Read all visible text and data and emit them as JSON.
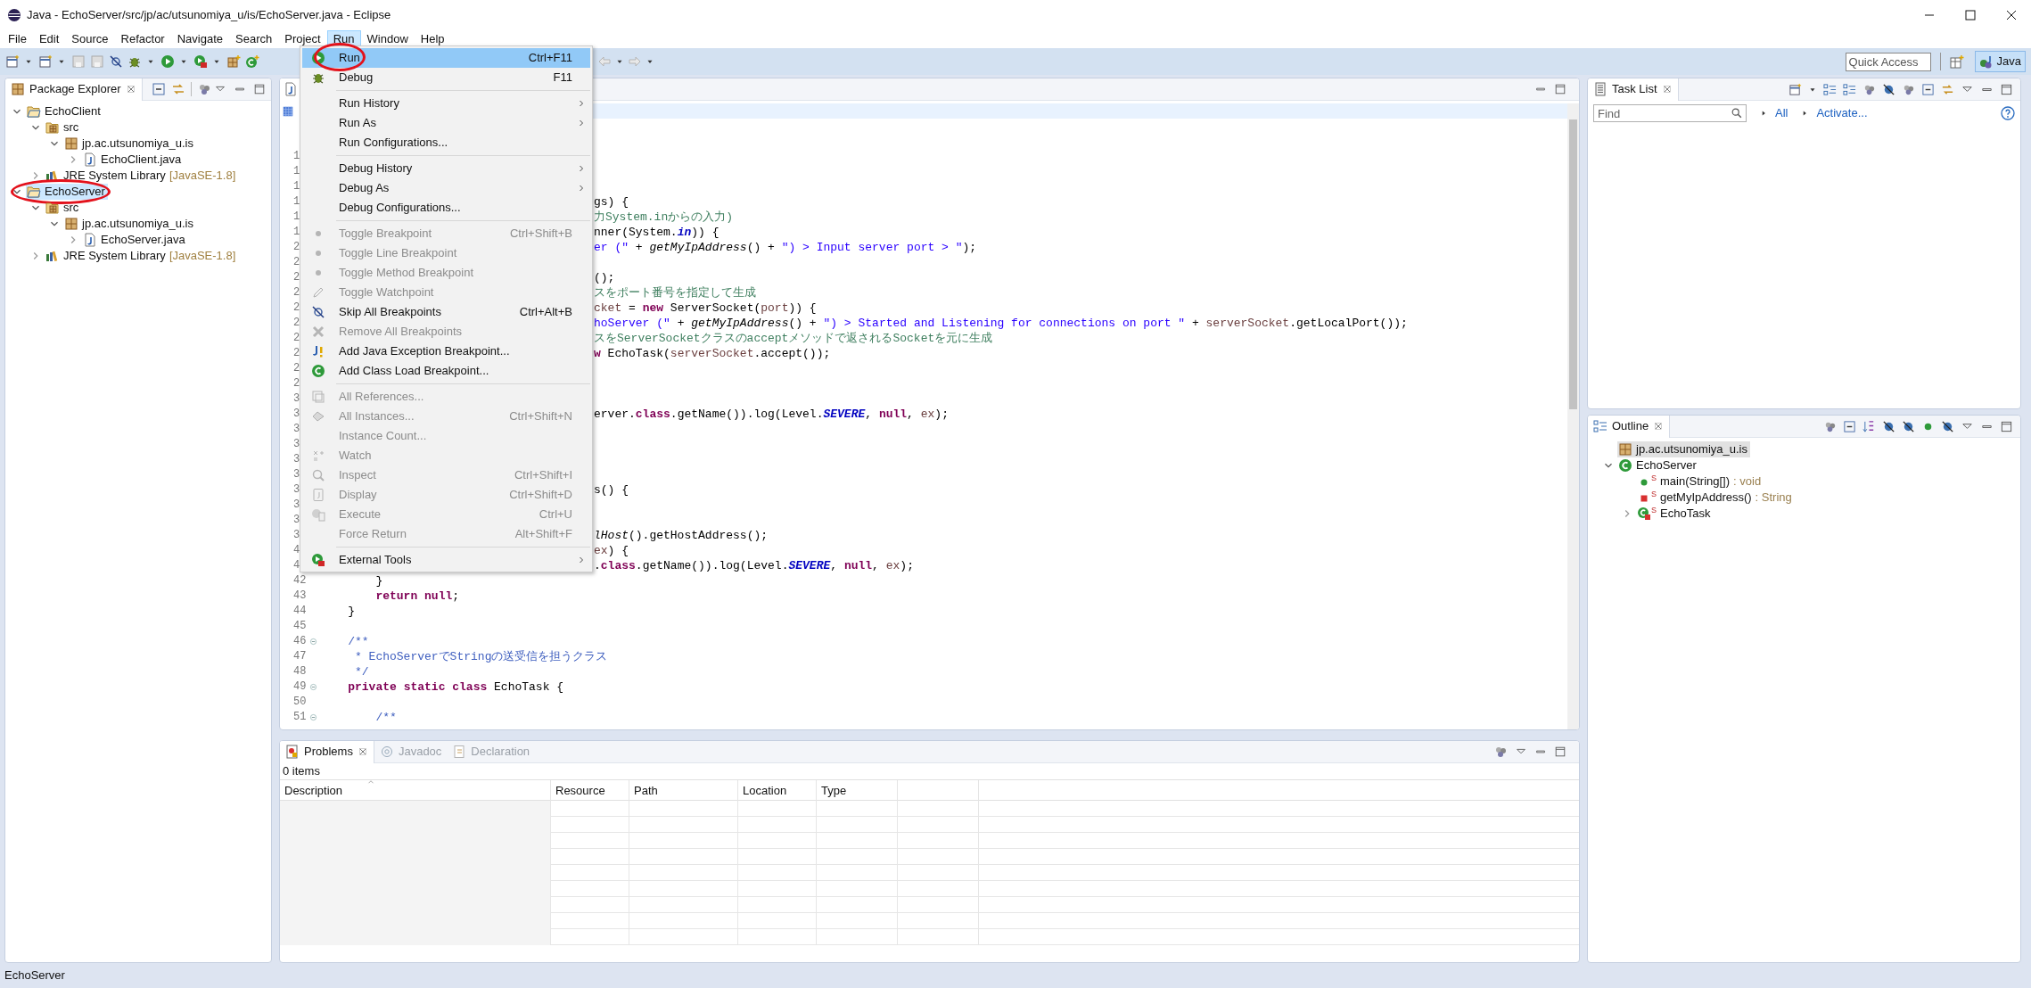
{
  "window": {
    "title": "Java - EchoServer/src/jp/ac/utsunomiya_u/is/EchoServer.java - Eclipse"
  },
  "menu_bar": [
    {
      "label": "File",
      "selected": false
    },
    {
      "label": "Edit",
      "selected": false
    },
    {
      "label": "Source",
      "selected": false
    },
    {
      "label": "Refactor",
      "selected": false
    },
    {
      "label": "Navigate",
      "selected": false
    },
    {
      "label": "Search",
      "selected": false
    },
    {
      "label": "Project",
      "selected": false
    },
    {
      "label": "Run",
      "selected": true
    },
    {
      "label": "Window",
      "selected": false
    },
    {
      "label": "Help",
      "selected": false
    }
  ],
  "toolbar": {
    "quick_access": {
      "placeholder": "Quick Access"
    },
    "perspective": {
      "label": "Java",
      "selected": true
    }
  },
  "run_menu": {
    "groups": [
      {
        "items": [
          {
            "label": "Run",
            "shortcut": "Ctrl+F11",
            "submenu": false,
            "disabled": false,
            "selected": true,
            "annotated": true
          },
          {
            "label": "Debug",
            "shortcut": "F11",
            "submenu": false,
            "disabled": false,
            "selected": false,
            "annotated": false
          }
        ]
      },
      {
        "items": [
          {
            "label": "Run History",
            "submenu": true,
            "disabled": false,
            "selected": false,
            "annotated": false
          },
          {
            "label": "Run As",
            "submenu": true,
            "disabled": false,
            "selected": false,
            "annotated": false
          },
          {
            "label": "Run Configurations...",
            "submenu": false,
            "disabled": false,
            "selected": false,
            "annotated": false
          }
        ]
      },
      {
        "items": [
          {
            "label": "Debug History",
            "submenu": true,
            "disabled": false,
            "selected": false,
            "annotated": false
          },
          {
            "label": "Debug As",
            "submenu": true,
            "disabled": false,
            "selected": false,
            "annotated": false
          },
          {
            "label": "Debug Configurations...",
            "submenu": false,
            "disabled": false,
            "selected": false,
            "annotated": false
          }
        ]
      },
      {
        "items": [
          {
            "label": "Toggle Breakpoint",
            "shortcut": "Ctrl+Shift+B",
            "submenu": false,
            "disabled": true,
            "selected": false,
            "annotated": false
          },
          {
            "label": "Toggle Line Breakpoint",
            "submenu": false,
            "disabled": true,
            "selected": false,
            "annotated": false
          },
          {
            "label": "Toggle Method Breakpoint",
            "submenu": false,
            "disabled": true,
            "selected": false,
            "annotated": false
          },
          {
            "label": "Toggle Watchpoint",
            "submenu": false,
            "disabled": true,
            "selected": false,
            "annotated": false
          },
          {
            "label": "Skip All Breakpoints",
            "shortcut": "Ctrl+Alt+B",
            "submenu": false,
            "disabled": false,
            "selected": false,
            "annotated": false
          },
          {
            "label": "Remove All Breakpoints",
            "submenu": false,
            "disabled": true,
            "selected": false,
            "annotated": false
          },
          {
            "label": "Add Java Exception Breakpoint...",
            "submenu": false,
            "disabled": false,
            "selected": false,
            "annotated": false
          },
          {
            "label": "Add Class Load Breakpoint...",
            "submenu": false,
            "disabled": false,
            "selected": false,
            "annotated": false
          }
        ]
      },
      {
        "items": [
          {
            "label": "All References...",
            "submenu": false,
            "disabled": true,
            "selected": false,
            "annotated": false
          },
          {
            "label": "All Instances...",
            "shortcut": "Ctrl+Shift+N",
            "submenu": false,
            "disabled": true,
            "selected": false,
            "annotated": false
          },
          {
            "label": "Instance Count...",
            "submenu": false,
            "disabled": true,
            "selected": false,
            "annotated": false
          },
          {
            "label": "Watch",
            "submenu": false,
            "disabled": true,
            "selected": false,
            "annotated": false
          },
          {
            "label": "Inspect",
            "shortcut": "Ctrl+Shift+I",
            "submenu": false,
            "disabled": true,
            "selected": false,
            "annotated": false
          },
          {
            "label": "Display",
            "shortcut": "Ctrl+Shift+D",
            "submenu": false,
            "disabled": true,
            "selected": false,
            "annotated": false
          },
          {
            "label": "Execute",
            "shortcut": "Ctrl+U",
            "submenu": false,
            "disabled": true,
            "selected": false,
            "annotated": false
          },
          {
            "label": "Force Return",
            "shortcut": "Alt+Shift+F",
            "submenu": false,
            "disabled": true,
            "selected": false,
            "annotated": false
          }
        ]
      },
      {
        "items": [
          {
            "label": "External Tools",
            "submenu": true,
            "disabled": false,
            "selected": false,
            "annotated": false
          }
        ]
      }
    ]
  },
  "package_explorer": {
    "title": "Package Explorer",
    "tree": [
      {
        "label": "EchoClient",
        "kind": "project",
        "expanded": true,
        "selected": false,
        "annotated": false,
        "children": [
          {
            "label": "src",
            "kind": "source-folder",
            "expanded": true,
            "selected": false,
            "annotated": false,
            "children": [
              {
                "label": "jp.ac.utsunomiya_u.is",
                "kind": "package",
                "expanded": true,
                "selected": false,
                "annotated": false,
                "children": [
                  {
                    "label": "EchoClient.java",
                    "kind": "java-file",
                    "expanded": false,
                    "selected": false,
                    "annotated": false
                  }
                ]
              }
            ]
          },
          {
            "label": "JRE System Library",
            "decoration": "[JavaSE-1.8]",
            "kind": "library",
            "expanded": false,
            "selected": false,
            "annotated": false
          }
        ]
      },
      {
        "label": "EchoServer",
        "kind": "project",
        "expanded": true,
        "selected": true,
        "annotated": true,
        "children": [
          {
            "label": "src",
            "kind": "source-folder",
            "expanded": true,
            "selected": false,
            "annotated": false,
            "children": [
              {
                "label": "jp.ac.utsunomiya_u.is",
                "kind": "package",
                "expanded": true,
                "selected": false,
                "annotated": false,
                "children": [
                  {
                    "label": "EchoServer.java",
                    "kind": "java-file",
                    "expanded": false,
                    "selected": false,
                    "annotated": false
                  }
                ]
              }
            ]
          },
          {
            "label": "JRE System Library",
            "decoration": "[JavaSE-1.8]",
            "kind": "library",
            "expanded": false,
            "selected": false,
            "annotated": false
          }
        ]
      }
    ]
  },
  "editor": {
    "lines": [
      {
        "current": true
      },
      {
        "current": false
      },
      {
        "current": false
      },
      {
        "number": "1",
        "current": false
      },
      {
        "number": "1",
        "current": false
      },
      {
        "number": "1",
        "current": false
      },
      {
        "number": "1",
        "kind": "partial",
        "current": false,
        "segments": [
          {
            "kind": "plain",
            "text": "gs) {"
          }
        ]
      },
      {
        "number": "1",
        "kind": "partial",
        "current": false,
        "segments": [
          {
            "kind": "comment",
            "text": "力System.inからの入力)"
          }
        ]
      },
      {
        "number": "1",
        "kind": "partial",
        "current": false,
        "segments": [
          {
            "kind": "plain",
            "text": "nner(System."
          },
          {
            "kind": "static-field",
            "text": "in"
          },
          {
            "kind": "plain",
            "text": ")) {"
          }
        ]
      },
      {
        "number": "2",
        "kind": "partial",
        "current": false,
        "segments": [
          {
            "kind": "string",
            "text": "er (\""
          },
          {
            "kind": "plain",
            "text": " + "
          },
          {
            "kind": "static-method",
            "text": "getMyIpAddress"
          },
          {
            "kind": "plain",
            "text": "() + "
          },
          {
            "kind": "string",
            "text": "\") > Input server port > \""
          },
          {
            "kind": "plain",
            "text": ");"
          }
        ]
      },
      {
        "number": "2",
        "current": false
      },
      {
        "number": "2",
        "kind": "partial",
        "current": false,
        "segments": [
          {
            "kind": "plain",
            "text": "();"
          }
        ]
      },
      {
        "number": "2",
        "kind": "partial",
        "current": false,
        "segments": [
          {
            "kind": "comment",
            "text": "スをポート番号を指定して生成"
          }
        ]
      },
      {
        "number": "2",
        "kind": "partial",
        "current": false,
        "segments": [
          {
            "kind": "variable",
            "text": "cket"
          },
          {
            "kind": "plain",
            "text": " = "
          },
          {
            "kind": "keyword",
            "text": "new"
          },
          {
            "kind": "plain",
            "text": " ServerSocket("
          },
          {
            "kind": "variable",
            "text": "port"
          },
          {
            "kind": "plain",
            "text": ")) {"
          }
        ]
      },
      {
        "number": "2",
        "kind": "partial",
        "current": false,
        "segments": [
          {
            "kind": "string",
            "text": "hoServer (\""
          },
          {
            "kind": "plain",
            "text": " + "
          },
          {
            "kind": "static-method",
            "text": "getMyIpAddress"
          },
          {
            "kind": "plain",
            "text": "() + "
          },
          {
            "kind": "string",
            "text": "\") > Started and Listening for connections on port \""
          },
          {
            "kind": "plain",
            "text": " + "
          },
          {
            "kind": "variable",
            "text": "serverSocket"
          },
          {
            "kind": "plain",
            "text": ".getLocalPort());"
          }
        ]
      },
      {
        "number": "2",
        "kind": "partial",
        "current": false,
        "segments": [
          {
            "kind": "comment",
            "text": "スをServerSocketクラスのacceptメソッドで返されるSocketを元に生成"
          }
        ]
      },
      {
        "number": "2",
        "kind": "partial",
        "current": false,
        "segments": [
          {
            "kind": "keyword",
            "text": "w"
          },
          {
            "kind": "plain",
            "text": " EchoTask("
          },
          {
            "kind": "variable",
            "text": "serverSocket"
          },
          {
            "kind": "plain",
            "text": ".accept());"
          }
        ]
      },
      {
        "number": "2",
        "current": false
      },
      {
        "number": "2",
        "current": false
      },
      {
        "number": "3",
        "current": false
      },
      {
        "number": "3",
        "kind": "partial",
        "current": false,
        "segments": [
          {
            "kind": "plain",
            "text": "erver."
          },
          {
            "kind": "keyword",
            "text": "class"
          },
          {
            "kind": "plain",
            "text": ".getName()).log(Level."
          },
          {
            "kind": "static-field",
            "text": "SEVERE"
          },
          {
            "kind": "plain",
            "text": ", "
          },
          {
            "kind": "keyword",
            "text": "null"
          },
          {
            "kind": "plain",
            "text": ", "
          },
          {
            "kind": "variable",
            "text": "ex"
          },
          {
            "kind": "plain",
            "text": ");"
          }
        ]
      },
      {
        "number": "3",
        "current": false
      },
      {
        "number": "3",
        "current": false
      },
      {
        "number": "3",
        "current": false
      },
      {
        "number": "3",
        "current": false
      },
      {
        "number": "3",
        "kind": "partial",
        "current": false,
        "segments": [
          {
            "kind": "plain",
            "text": "s() {"
          }
        ]
      },
      {
        "number": "3",
        "current": false
      },
      {
        "number": "3",
        "current": false
      },
      {
        "number": "3",
        "kind": "partial",
        "current": false,
        "segments": [
          {
            "kind": "static-method",
            "text": "lHost"
          },
          {
            "kind": "plain",
            "text": "().getHostAddress();"
          }
        ]
      },
      {
        "number": "4",
        "kind": "partial",
        "current": false,
        "segments": [
          {
            "kind": "variable",
            "text": "ex"
          },
          {
            "kind": "plain",
            "text": ") {"
          }
        ]
      },
      {
        "number": "4",
        "kind": "partial",
        "current": false,
        "segments": [
          {
            "kind": "plain",
            "text": "."
          },
          {
            "kind": "keyword",
            "text": "class"
          },
          {
            "kind": "plain",
            "text": ".getName()).log(Level."
          },
          {
            "kind": "static-field",
            "text": "SEVERE"
          },
          {
            "kind": "plain",
            "text": ", "
          },
          {
            "kind": "keyword",
            "text": "null"
          },
          {
            "kind": "plain",
            "text": ", "
          },
          {
            "kind": "variable",
            "text": "ex"
          },
          {
            "kind": "plain",
            "text": ");"
          }
        ]
      },
      {
        "number": "42",
        "kind": "full",
        "current": false,
        "segments": [
          {
            "kind": "plain",
            "text": "        }"
          }
        ]
      },
      {
        "number": "43",
        "kind": "full",
        "current": false,
        "segments": [
          {
            "kind": "keyword",
            "text": "        return "
          },
          {
            "kind": "keyword",
            "text": "null"
          },
          {
            "kind": "plain",
            "text": ";"
          }
        ]
      },
      {
        "number": "44",
        "kind": "full",
        "current": false,
        "segments": [
          {
            "kind": "plain",
            "text": "    }"
          }
        ]
      },
      {
        "number": "45",
        "current": false
      },
      {
        "number": "46",
        "kind": "full",
        "current": false,
        "fold": true,
        "segments": [
          {
            "kind": "javadoc",
            "text": "    /**"
          }
        ]
      },
      {
        "number": "47",
        "kind": "full",
        "current": false,
        "segments": [
          {
            "kind": "javadoc",
            "text": "     * EchoServerでStringの送受信を担うクラス"
          }
        ]
      },
      {
        "number": "48",
        "kind": "full",
        "current": false,
        "segments": [
          {
            "kind": "javadoc",
            "text": "     */"
          }
        ]
      },
      {
        "number": "49",
        "kind": "full",
        "current": false,
        "fold": true,
        "segments": [
          {
            "kind": "keyword",
            "text": "    private "
          },
          {
            "kind": "keyword",
            "text": "static "
          },
          {
            "kind": "keyword",
            "text": "class "
          },
          {
            "kind": "plain",
            "text": "EchoTask {"
          }
        ]
      },
      {
        "number": "50",
        "current": false
      },
      {
        "number": "51",
        "kind": "full",
        "current": false,
        "fold": true,
        "segments": [
          {
            "kind": "javadoc",
            "text": "        /**"
          }
        ]
      }
    ]
  },
  "task_list": {
    "title": "Task List",
    "find": {
      "placeholder": "Find"
    },
    "links": [
      "All",
      "Activate..."
    ]
  },
  "outline": {
    "title": "Outline",
    "tree": [
      {
        "label": "jp.ac.utsunomiya_u.is",
        "kind": "package",
        "selected": true
      },
      {
        "label": "EchoServer",
        "kind": "class",
        "expanded": true,
        "selected": false,
        "children": [
          {
            "label": "main(String[])",
            "detail": ": void",
            "mark": "S",
            "kind": "public-method",
            "selected": false
          },
          {
            "label": "getMyIpAddress()",
            "detail": ": String",
            "mark": "S",
            "kind": "private-method",
            "selected": false
          },
          {
            "label": "EchoTask",
            "mark": "S",
            "kind": "private-class",
            "expanded": false,
            "selected": false
          }
        ]
      }
    ]
  },
  "problems": {
    "tabs": [
      {
        "label": "Problems",
        "selected": true
      },
      {
        "label": "Javadoc",
        "selected": false
      },
      {
        "label": "Declaration",
        "selected": false
      }
    ],
    "summary": "0 items",
    "columns": [
      "Description",
      "Resource",
      "Path",
      "Location",
      "Type"
    ]
  },
  "status_bar": {
    "text": "EchoServer"
  }
}
